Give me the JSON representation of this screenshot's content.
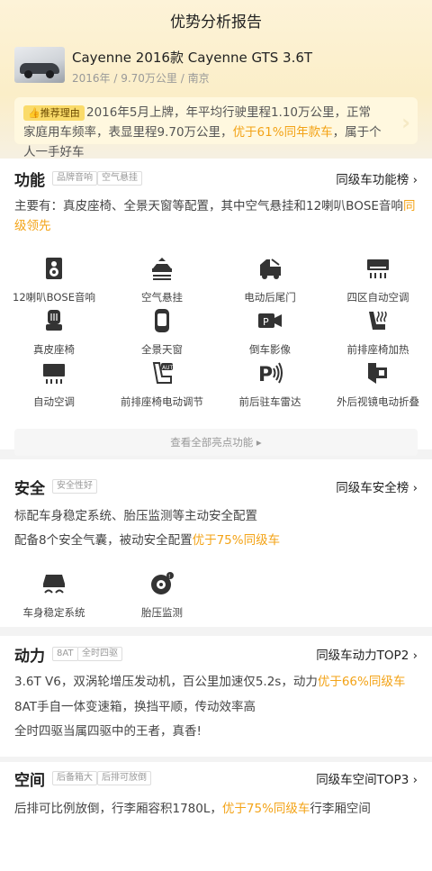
{
  "page": {
    "title": "优势分析报告"
  },
  "car": {
    "name": "Cayenne 2016款 Cayenne GTS 3.6T",
    "meta": "2016年 / 9.70万公里 / 南京"
  },
  "recommend": {
    "badge": "推荐理由",
    "text_a": "2016年5月上牌，年平均行驶里程1.10万公里，正常家庭用车频率，表显里程9.70万公里，",
    "text_hl": "优于61%同年款车",
    "text_b": "，属于个人一手好车"
  },
  "function": {
    "title": "功能",
    "tags": [
      "品牌音响",
      "空气悬挂"
    ],
    "rank": "同级车功能榜",
    "desc_a": "主要有：真皮座椅、全景天窗等配置，其中空气悬挂和12喇叭BOSE音响",
    "desc_hl": "同级领先",
    "features": [
      {
        "label": "12喇叭BOSE音响",
        "icon": "speaker-icon"
      },
      {
        "label": "空气悬挂",
        "icon": "air-suspension-icon"
      },
      {
        "label": "电动后尾门",
        "icon": "power-tailgate-icon"
      },
      {
        "label": "四区自动空调",
        "icon": "four-zone-ac-icon"
      },
      {
        "label": "真皮座椅",
        "icon": "leather-seat-icon"
      },
      {
        "label": "全景天窗",
        "icon": "panoramic-sunroof-icon"
      },
      {
        "label": "倒车影像",
        "icon": "reverse-camera-icon"
      },
      {
        "label": "前排座椅加热",
        "icon": "seat-heating-icon"
      },
      {
        "label": "自动空调",
        "icon": "auto-ac-icon"
      },
      {
        "label": "前排座椅电动调节",
        "icon": "power-seat-icon"
      },
      {
        "label": "前后驻车雷达",
        "icon": "parking-radar-icon"
      },
      {
        "label": "外后视镜电动折叠",
        "icon": "mirror-fold-icon"
      }
    ],
    "view_all": "查看全部亮点功能"
  },
  "safety": {
    "title": "安全",
    "tag": "安全性好",
    "rank": "同级车安全榜",
    "line1": "标配车身稳定系统、胎压监测等主动安全配置",
    "line2_a": "配备8个安全气囊，被动安全配置",
    "line2_hl": "优于75%同级车",
    "features": [
      {
        "label": "车身稳定系统",
        "icon": "stability-control-icon"
      },
      {
        "label": "胎压监测",
        "icon": "tire-pressure-icon"
      }
    ]
  },
  "power": {
    "title": "动力",
    "tags": [
      "8AT",
      "全时四驱"
    ],
    "rank": "同级车动力TOP2",
    "line1_a": "3.6T V6，双涡轮增压发动机，百公里加速仅5.2s，动力",
    "line1_hl": "优于66%同级车",
    "line2": "8AT手自一体变速箱，换挡平顺，传动效率高",
    "line3": "全时四驱当属四驱中的王者，真香!"
  },
  "space": {
    "title": "空间",
    "tags": [
      "后备箱大",
      "后排可放倒"
    ],
    "rank": "同级车空间TOP3",
    "line_a": "后排可比例放倒，行李厢容积1780L，",
    "line_hl": "优于75%同级车",
    "line_b": "行李厢空间"
  },
  "colors": {
    "accent": "#f3a317",
    "badge": "#fadb6a",
    "hero": "#fbeec8"
  }
}
